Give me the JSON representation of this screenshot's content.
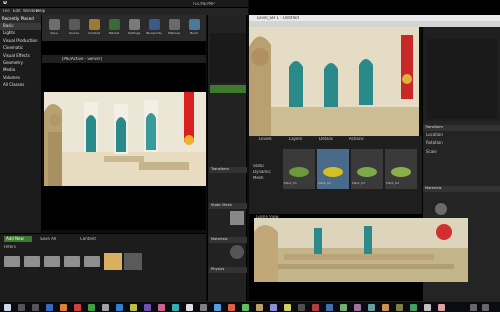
{
  "ue": {
    "window_title": "TGCMEPMP",
    "menu": [
      "File",
      "Edit",
      "Window",
      "Help"
    ],
    "toolbar": [
      {
        "label": "Save",
        "color": "#6e6e6e"
      },
      {
        "label": "Source",
        "color": "#5a5a5a"
      },
      {
        "label": "Content",
        "color": "#9a7a3a"
      },
      {
        "label": "Market",
        "color": "#3a6a3a"
      },
      {
        "label": "Settings",
        "color": "#7a7a7a"
      },
      {
        "label": "Blueprints",
        "color": "#3a5a8a"
      },
      {
        "label": "Matinee",
        "color": "#6a6a6a"
      },
      {
        "label": "Build",
        "color": "#4a7a9a"
      }
    ],
    "modes": {
      "header": "Recently Placed",
      "items": [
        "Basic",
        "Lights",
        "Visual Production",
        "Cinematic",
        "Visual Effects",
        "Geometry",
        "Media",
        "Volumes",
        "All Classes"
      ],
      "selected": 0
    },
    "viewport_label": "[PIE/Active - Server]",
    "details": {
      "sections": [
        "Transform",
        "Static Mesh",
        "Materials",
        "Physics"
      ]
    },
    "content_browser": {
      "tabs": [
        "Add New",
        "Save All",
        "Content"
      ],
      "filters": "Filters"
    }
  },
  "right": {
    "title": "Level_SH 1 - Untitled",
    "tabs": [
      "Levels",
      "Layers",
      "Details",
      "Actions"
    ],
    "filter_items": [
      "Static",
      "Dynamic",
      "Mesh"
    ],
    "thumb_labels": [
      "Plant_01",
      "Plant_02",
      "Plant_03",
      "Plant_04"
    ],
    "props": [
      "Transform",
      "Location",
      "Rotation",
      "Scale",
      "Materials"
    ],
    "viewport_label": "Game View"
  }
}
